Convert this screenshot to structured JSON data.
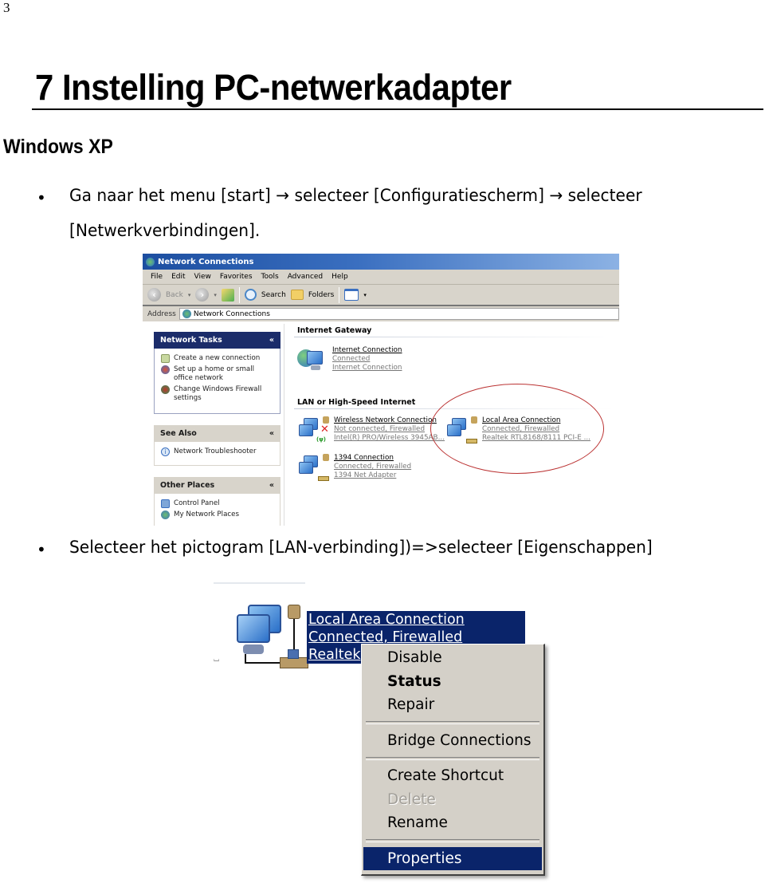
{
  "page_number": "3",
  "heading": "7  Instelling PC-netwerkadapter",
  "subheading": "Windows XP",
  "bullets": [
    {
      "line1": "Ga naar het menu [start] → selecteer [Configuratiescherm] → selecteer",
      "line2": "[Netwerkverbindingen]."
    },
    {
      "line1": "Selecteer het pictogram [LAN-verbinding])=>selecteer [Eigenschappen]"
    }
  ],
  "screenshot1": {
    "title": "Network Connections",
    "menu": [
      "File",
      "Edit",
      "View",
      "Favorites",
      "Tools",
      "Advanced",
      "Help"
    ],
    "toolbar": {
      "back": "Back",
      "search": "Search",
      "folders": "Folders"
    },
    "address": {
      "label": "Address",
      "value": "Network Connections"
    },
    "task_panes": [
      {
        "title": "Network Tasks",
        "items": [
          "Create a new connection",
          "Set up a home or small office network",
          "Change Windows Firewall settings"
        ]
      },
      {
        "title": "See Also",
        "items": [
          "Network Troubleshooter"
        ]
      },
      {
        "title": "Other Places",
        "items": [
          "Control Panel",
          "My Network Places"
        ]
      }
    ],
    "groups": [
      {
        "title": "Internet Gateway",
        "connections": [
          {
            "name": "Internet Connection",
            "status": "Connected",
            "device": "Internet Connection"
          }
        ]
      },
      {
        "title": "LAN or High-Speed Internet",
        "connections": [
          {
            "name": "Wireless Network Connection",
            "status": "Not connected, Firewalled",
            "device": "Intel(R) PRO/Wireless 3945AB..."
          },
          {
            "name": "Local Area Connection",
            "status": "Connected, Firewalled",
            "device": "Realtek RTL8168/8111 PCI-E ..."
          },
          {
            "name": "1394 Connection",
            "status": "Connected, Firewalled",
            "device": "1394 Net Adapter"
          }
        ]
      }
    ],
    "highlight_color": "#b33333"
  },
  "screenshot2": {
    "selected": {
      "name": "Local Area Connection",
      "status": "Connected, Firewalled",
      "device": "Realtek"
    },
    "context_menu": {
      "items": [
        {
          "label": "Disable"
        },
        {
          "label": "Status",
          "default": true
        },
        {
          "label": "Repair"
        },
        {
          "label": "Bridge Connections"
        },
        {
          "label": "Create Shortcut"
        },
        {
          "label": "Delete",
          "disabled": true
        },
        {
          "label": "Rename"
        },
        {
          "label": "Properties",
          "highlighted": true
        }
      ]
    },
    "selection_color": "#0a246a"
  }
}
